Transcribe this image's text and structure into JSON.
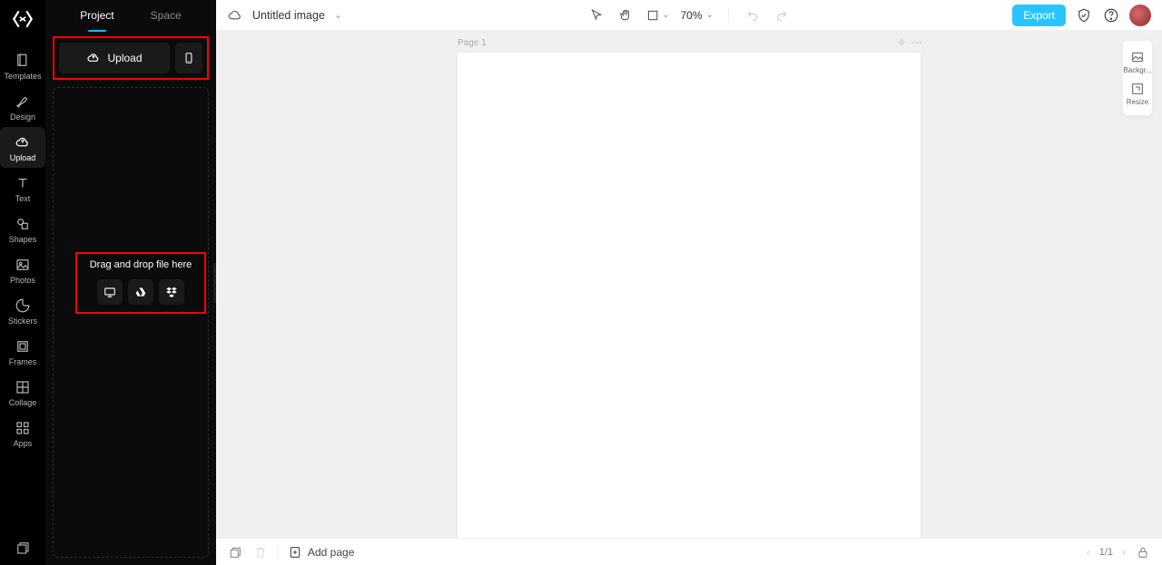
{
  "rail": {
    "items": [
      {
        "label": "Templates",
        "icon": "templates"
      },
      {
        "label": "Design",
        "icon": "design"
      },
      {
        "label": "Upload",
        "icon": "upload",
        "active": true
      },
      {
        "label": "Text",
        "icon": "text"
      },
      {
        "label": "Shapes",
        "icon": "shapes"
      },
      {
        "label": "Photos",
        "icon": "photos"
      },
      {
        "label": "Stickers",
        "icon": "stickers"
      },
      {
        "label": "Frames",
        "icon": "frames"
      },
      {
        "label": "Collage",
        "icon": "collage"
      },
      {
        "label": "Apps",
        "icon": "apps"
      }
    ]
  },
  "panel": {
    "tabs": {
      "project": "Project",
      "space": "Space"
    },
    "upload_label": "Upload",
    "drop_text": "Drag and drop file here"
  },
  "topbar": {
    "title": "Untitled image",
    "zoom": "70%",
    "export": "Export"
  },
  "canvas": {
    "page_label": "Page 1"
  },
  "dock": {
    "background": "Backgr...",
    "resize": "Resize"
  },
  "bottombar": {
    "addpage": "Add page",
    "pagecount": "1/1"
  }
}
